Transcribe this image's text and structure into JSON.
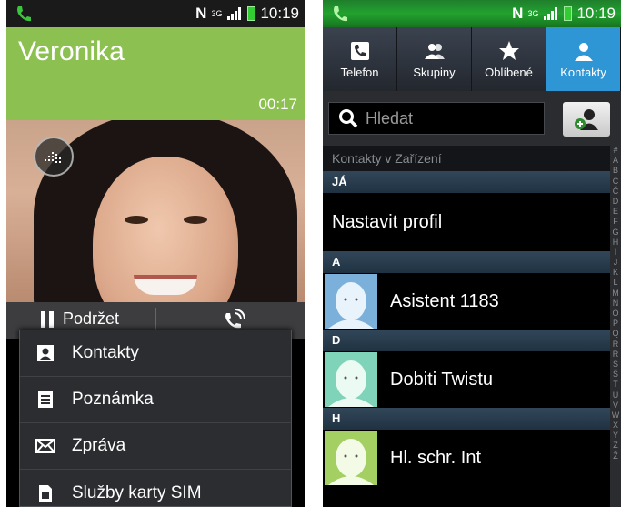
{
  "status_left": {
    "network": "N",
    "data": "3G",
    "time": "10:19"
  },
  "status_right": {
    "network": "N",
    "data": "3G",
    "time": "10:19"
  },
  "call": {
    "caller_name": "Veronika",
    "duration": "00:17",
    "hold_label": "Podržet",
    "header_color": "#8cc152"
  },
  "call_menu": {
    "items": [
      {
        "label": "Kontakty",
        "icon": "contact-card-icon"
      },
      {
        "label": "Poznámka",
        "icon": "note-icon"
      },
      {
        "label": "Zpráva",
        "icon": "envelope-icon"
      },
      {
        "label": "Služby karty SIM",
        "icon": "sim-card-icon"
      }
    ]
  },
  "tabs": [
    {
      "label": "Telefon",
      "icon": "phone-icon",
      "active": false
    },
    {
      "label": "Skupiny",
      "icon": "groups-icon",
      "active": false
    },
    {
      "label": "Oblíbené",
      "icon": "star-icon",
      "active": false
    },
    {
      "label": "Kontakty",
      "icon": "person-icon",
      "active": true
    }
  ],
  "search": {
    "placeholder": "Hledat"
  },
  "contacts": {
    "section_title": "Kontakty v Zařízení",
    "me_header": "JÁ",
    "profile_label": "Nastavit profil",
    "groups": [
      {
        "letter": "A",
        "name": "Asistent 1183"
      },
      {
        "letter": "D",
        "name": "Dobiti Twistu"
      },
      {
        "letter": "H",
        "name": "Hl. schr. Int"
      }
    ]
  },
  "index_letters": [
    "#",
    "A",
    "B",
    "C",
    "Č",
    "D",
    "E",
    "F",
    "G",
    "H",
    "I",
    "J",
    "K",
    "L",
    "M",
    "N",
    "O",
    "P",
    "Q",
    "R",
    "Ř",
    "S",
    "Š",
    "T",
    "U",
    "V",
    "W",
    "X",
    "Y",
    "Z",
    "Ž"
  ],
  "colors": {
    "active_tab": "#2f96d6",
    "battery": "#33cc33",
    "status_green": "#22a22f"
  }
}
